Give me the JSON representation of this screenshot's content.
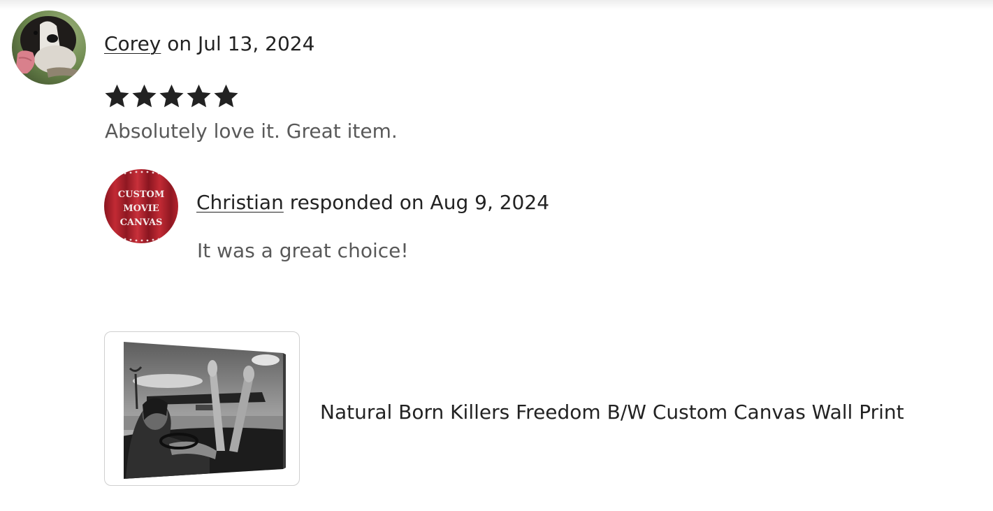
{
  "review": {
    "reviewer_name": "Corey",
    "reviewer_date_text": " on Jul 13, 2024",
    "rating": 5,
    "rating_max": 5,
    "text": "Absolutely love it. Great item."
  },
  "response": {
    "seller_name": "Christian",
    "seller_date_text": " responded on Aug 9, 2024",
    "text": "It was a great choice!",
    "avatar_logo_lines": [
      "CUSTOM",
      "MOVIE",
      "CANVAS"
    ]
  },
  "item": {
    "title": "Natural Born Killers Freedom B/W Custom Canvas Wall Print"
  },
  "colors": {
    "text_primary": "#222222",
    "text_secondary": "#595959",
    "star": "#222222",
    "card_border": "#cfcfcf",
    "seller_avatar_red": "#b0202a"
  },
  "icons": {
    "star": "star-icon"
  }
}
